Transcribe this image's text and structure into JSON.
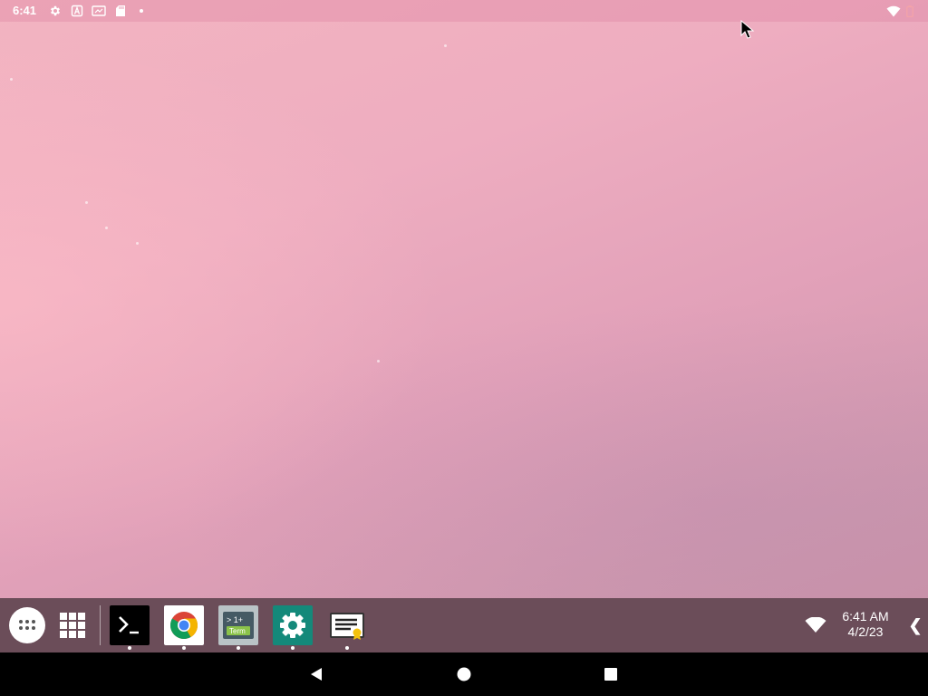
{
  "status_bar": {
    "time": "6:41",
    "left_icons": [
      "gear-icon",
      "keyboard-a-icon",
      "screencast-icon",
      "sd-card-icon",
      "notification-dot"
    ],
    "right_icons": [
      "wifi-icon",
      "battery-icon"
    ]
  },
  "taskbar": {
    "start_button": "all-apps-icon",
    "overview_button": "grid-icon",
    "apps": [
      {
        "name": "Terminal",
        "icon": "terminal-icon"
      },
      {
        "name": "Chrome",
        "icon": "chrome-icon"
      },
      {
        "name": "Term",
        "icon": "term-icon",
        "badge_top": "> 1+",
        "badge_bottom": "Term"
      },
      {
        "name": "Settings",
        "icon": "settings-icon"
      },
      {
        "name": "Notes",
        "icon": "notes-icon"
      }
    ],
    "clock_time": "6:41 AM",
    "clock_date": "4/2/23",
    "wifi_icon": "wifi-icon",
    "collapse_glyph": "❮"
  },
  "nav_bar": {
    "buttons": [
      "back-icon",
      "home-icon",
      "recents-icon"
    ]
  },
  "colors": {
    "wallpaper_top": "#f3b4c1",
    "wallpaper_bottom": "#c98ea4",
    "taskbar": "#6b4d59",
    "nav_bar": "#000000",
    "settings_tile": "#14897a"
  }
}
